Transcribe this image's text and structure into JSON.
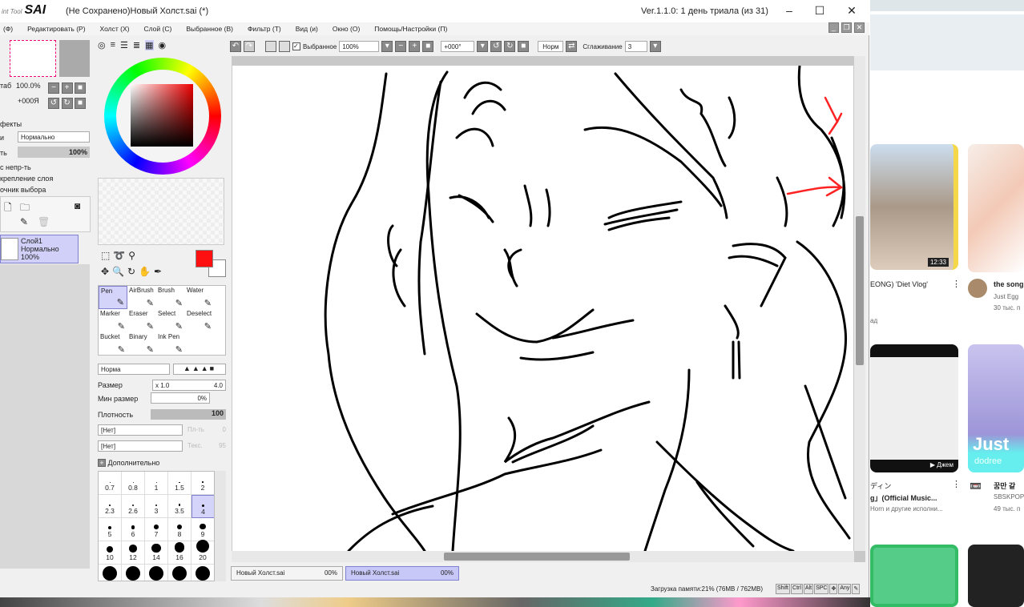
{
  "app": {
    "logo": "SAI",
    "logo_prefix": "int Tool",
    "title": "(Не Сохранено)Новый Холст.sai (*)",
    "version": "Ver.1.1.0: 1 день триала (из 31)"
  },
  "menu": [
    "(Ф)",
    "Редактировать (Р)",
    "Холст (Х)",
    "Слой (С)",
    "Выбранное (В)",
    "Фильтр (Т)",
    "Вид (и)",
    "Окно (О)",
    "Помощь/Настройки (П)"
  ],
  "toolbar": {
    "selected_label": "Выбранное",
    "zoom": "100%",
    "rotation": "+000°",
    "mode": "Норм",
    "smoothing_label": "Сглаживание",
    "smoothing": "3"
  },
  "navigator": {
    "zoom_label": "таб",
    "zoom": "100.0%",
    "angle": "+000Я"
  },
  "layer_panel": {
    "effects": "фекты",
    "blend_label": "и",
    "blend": "Нормально",
    "opacity_label": "ть",
    "opacity": "100%",
    "opt1": "с непр-ть",
    "opt2": "крепление слоя",
    "opt3": "очник выбора",
    "layer": {
      "name": "Слой1",
      "mode": "Нормально",
      "opacity": "100%"
    }
  },
  "colors": {
    "primary": "#ff1010",
    "secondary": "#ffffff"
  },
  "tools": [
    {
      "name": "Pen",
      "selected": true
    },
    {
      "name": "AirBrush"
    },
    {
      "name": "Brush"
    },
    {
      "name": "Water"
    },
    {
      "name": "Marker"
    },
    {
      "name": "Eraser"
    },
    {
      "name": "Select"
    },
    {
      "name": "Deselect"
    },
    {
      "name": "Bucket"
    },
    {
      "name": "Binary"
    },
    {
      "name": "Ink Pen"
    }
  ],
  "brush": {
    "blend": "Норма",
    "size_label": "Размер",
    "size_mult": "x 1.0",
    "size": "4.0",
    "min_label": "Мин размер",
    "min": "0%",
    "density_label": "Плотность",
    "density": "100",
    "tex1": "[Нет]",
    "tex1_side": "Пл-ть",
    "tex1_val": "0",
    "tex2": "[Нет]",
    "tex2_side": "Текс.",
    "tex2_val": "95",
    "advanced": "Дополнительно"
  },
  "sizes": [
    "0.7",
    "0.8",
    "1",
    "1.5",
    "2",
    "2.3",
    "2.6",
    "3",
    "3.5",
    "4",
    "5",
    "6",
    "7",
    "8",
    "9",
    "10",
    "12",
    "14",
    "16",
    "20"
  ],
  "selected_size": "4",
  "tabs": [
    {
      "name": "Новый Холст.sai",
      "pct": "00%"
    },
    {
      "name": "Новый Холст.sai",
      "pct": "00%",
      "active": true
    }
  ],
  "status": {
    "memory": "Загрузка памяти:21% (76MB / 762MB)",
    "keys": [
      "Shift",
      "Ctrl",
      "Alt",
      "SPC",
      "✥",
      "Any",
      "✎"
    ]
  },
  "browser": {
    "videos": [
      {
        "title": "EONG) 'Diet Vlog'",
        "meta": "ад",
        "duration": "12:33"
      },
      {
        "title": "the song",
        "channel": "Just Egg",
        "views": "30 тыс. п"
      },
      {
        "title": "ディン",
        "title2": "g」(Official Music...",
        "meta": "Horn и другие исполни...",
        "badge": "▶ Джем"
      },
      {
        "title": "꿈만 같",
        "channel": "SBSKPOP",
        "views": "49 тыс. п",
        "overlay": "Just",
        "overlay2": "dodree"
      }
    ]
  }
}
